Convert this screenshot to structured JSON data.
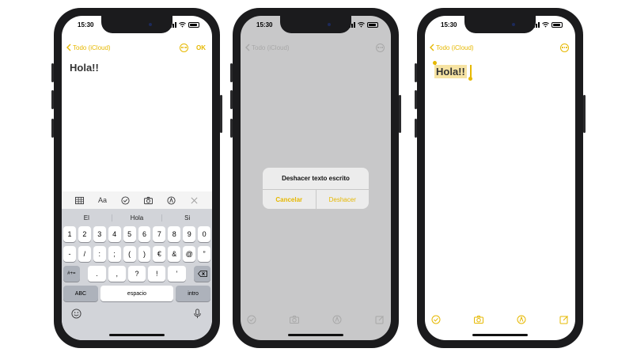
{
  "colors": {
    "accent": "#e6b800",
    "dim_background": "#c8c8c9",
    "keyboard": "#d2d4d9"
  },
  "phone1": {
    "status": {
      "time": "15:30"
    },
    "navbar": {
      "back_label": "Todo (iCloud)",
      "ok_label": "OK"
    },
    "note": {
      "title": "Hola!!"
    },
    "toolbar": {
      "format_label": "Aa"
    },
    "suggestions": [
      "El",
      "Hola",
      "Si"
    ],
    "keyboard": {
      "row1": [
        "1",
        "2",
        "3",
        "4",
        "5",
        "6",
        "7",
        "8",
        "9",
        "0"
      ],
      "row2": [
        "-",
        "/",
        ":",
        ";",
        "(",
        ")",
        "€",
        "&",
        "@",
        "”"
      ],
      "row3": {
        "symbols": "#+=",
        "keys": [
          ".",
          ",",
          "?",
          "!",
          "’"
        ]
      },
      "abc": "ABC",
      "space": "espacio",
      "return": "intro"
    }
  },
  "phone2": {
    "status": {
      "time": "15:30"
    },
    "navbar": {
      "back_label": "Todo (iCloud)"
    },
    "alert": {
      "title": "Deshacer texto escrito",
      "cancel": "Cancelar",
      "confirm": "Deshacer"
    }
  },
  "phone3": {
    "status": {
      "time": "15:30"
    },
    "navbar": {
      "back_label": "Todo (iCloud)"
    },
    "note": {
      "title": "Hola!!"
    }
  }
}
